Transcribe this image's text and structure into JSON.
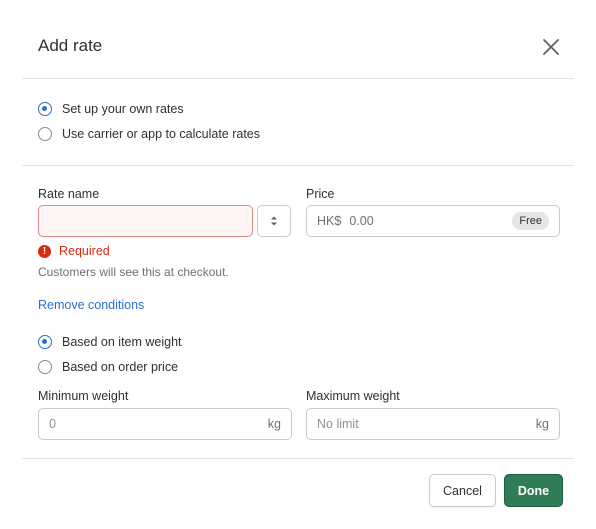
{
  "dialog": {
    "title": "Add rate",
    "close_icon": "close-icon"
  },
  "rate_type": {
    "options": [
      {
        "label": "Set up your own rates",
        "checked": true
      },
      {
        "label": "Use carrier or app to calculate rates",
        "checked": false
      }
    ]
  },
  "rate_name": {
    "label": "Rate name",
    "value": "",
    "error": "Required",
    "help": "Customers will see this at checkout."
  },
  "price": {
    "label": "Price",
    "currency": "HK$",
    "value": "0.00",
    "badge": "Free"
  },
  "conditions": {
    "remove_link": "Remove conditions",
    "options": [
      {
        "label": "Based on item weight",
        "checked": true
      },
      {
        "label": "Based on order price",
        "checked": false
      }
    ]
  },
  "min_weight": {
    "label": "Minimum weight",
    "placeholder": "0",
    "unit": "kg"
  },
  "max_weight": {
    "label": "Maximum weight",
    "placeholder": "No limit",
    "unit": "kg"
  },
  "footer": {
    "cancel_label": "Cancel",
    "done_label": "Done"
  },
  "colors": {
    "primary_button": "#2e7d55",
    "link": "#2c6ecb",
    "error": "#d72c0d"
  }
}
